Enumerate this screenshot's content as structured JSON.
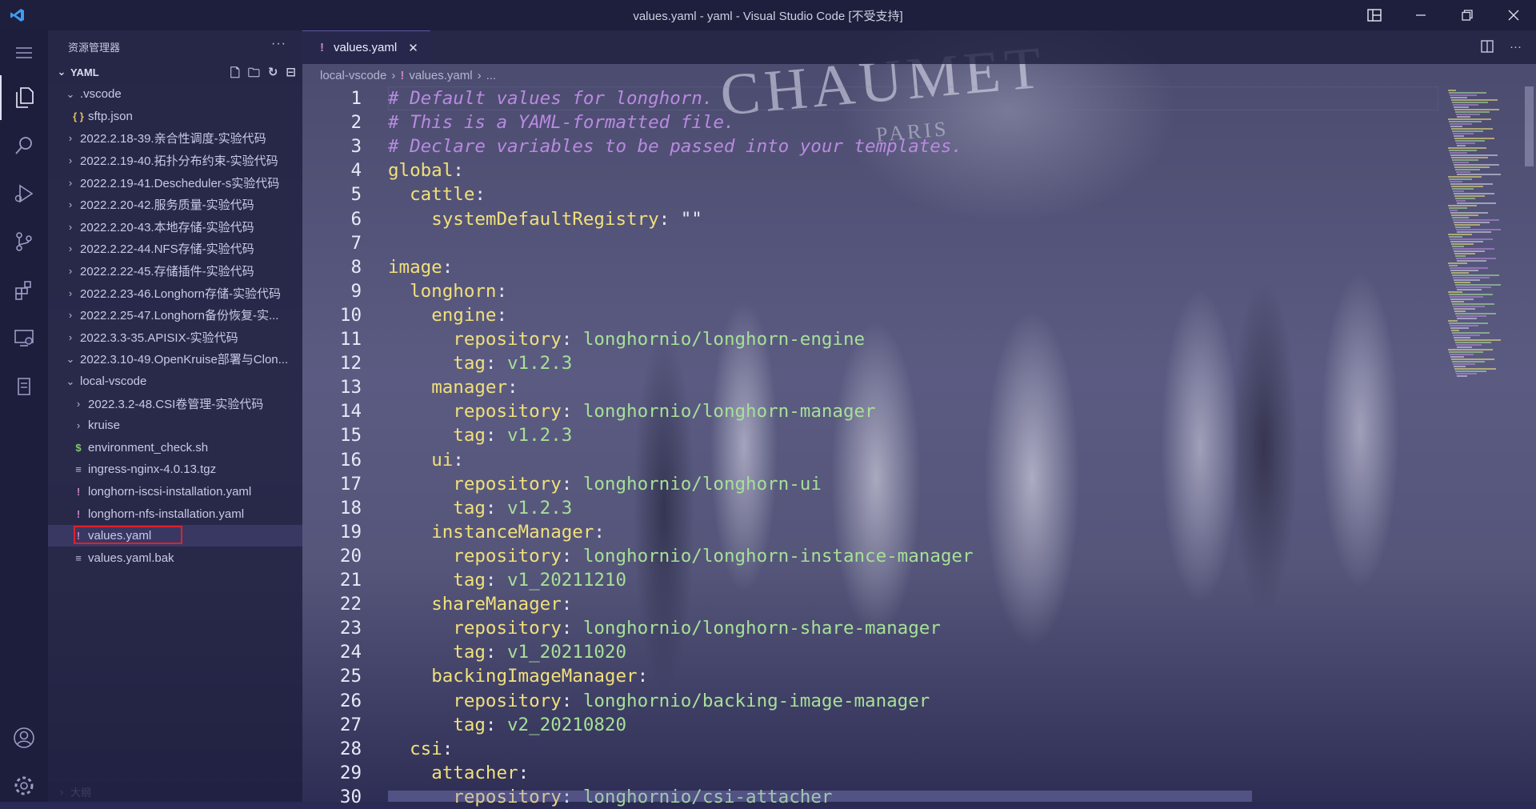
{
  "window": {
    "title": "values.yaml - yaml - Visual Studio Code [不受支持]"
  },
  "explorer": {
    "header": "资源管理器",
    "more": "···",
    "section": "YAML",
    "outline": "大纲",
    "tree": [
      {
        "label": ".vscode",
        "type": "folder",
        "open": true,
        "depth": 1
      },
      {
        "label": "sftp.json",
        "type": "json",
        "depth": 2
      },
      {
        "label": "2022.2.18-39.亲合性调度-实验代码",
        "type": "folder",
        "open": false,
        "depth": 1
      },
      {
        "label": "2022.2.19-40.拓扑分布约束-实验代码",
        "type": "folder",
        "open": false,
        "depth": 1
      },
      {
        "label": "2022.2.19-41.Descheduler-s实验代码",
        "type": "folder",
        "open": false,
        "depth": 1
      },
      {
        "label": "2022.2.20-42.服务质量-实验代码",
        "type": "folder",
        "open": false,
        "depth": 1
      },
      {
        "label": "2022.2.20-43.本地存储-实验代码",
        "type": "folder",
        "open": false,
        "depth": 1
      },
      {
        "label": "2022.2.22-44.NFS存储-实验代码",
        "type": "folder",
        "open": false,
        "depth": 1
      },
      {
        "label": "2022.2.22-45.存储插件-实验代码",
        "type": "folder",
        "open": false,
        "depth": 1
      },
      {
        "label": "2022.2.23-46.Longhorn存储-实验代码",
        "type": "folder",
        "open": false,
        "depth": 1
      },
      {
        "label": "2022.2.25-47.Longhorn备份恢复-实...",
        "type": "folder",
        "open": false,
        "depth": 1
      },
      {
        "label": "2022.3.3-35.APISIX-实验代码",
        "type": "folder",
        "open": false,
        "depth": 1
      },
      {
        "label": "2022.3.10-49.OpenKruise部署与Clon...",
        "type": "folder",
        "open": true,
        "depth": 1
      },
      {
        "label": "local-vscode",
        "type": "folder",
        "open": true,
        "depth": 1
      },
      {
        "label": "2022.3.2-48.CSI卷管理-实验代码",
        "type": "folder",
        "open": false,
        "depth": 2
      },
      {
        "label": "kruise",
        "type": "folder",
        "open": false,
        "depth": 2
      },
      {
        "label": "environment_check.sh",
        "type": "shell",
        "depth": 2
      },
      {
        "label": "ingress-nginx-4.0.13.tgz",
        "type": "file",
        "depth": 2
      },
      {
        "label": "longhorn-iscsi-installation.yaml",
        "type": "yaml",
        "depth": 2
      },
      {
        "label": "longhorn-nfs-installation.yaml",
        "type": "yaml",
        "depth": 2
      },
      {
        "label": "values.yaml",
        "type": "yaml",
        "depth": 2,
        "selected": true
      },
      {
        "label": "values.yaml.bak",
        "type": "file",
        "depth": 2
      }
    ]
  },
  "tab": {
    "label": "values.yaml",
    "close": "✕"
  },
  "breadcrumb": [
    "local-vscode",
    "values.yaml",
    "..."
  ],
  "editor": {
    "lines": [
      [
        [
          "comment",
          "# Default values for longhorn."
        ]
      ],
      [
        [
          "comment",
          "# This is a YAML-formatted file."
        ]
      ],
      [
        [
          "comment",
          "# Declare variables to be passed into your templates."
        ]
      ],
      [
        [
          "key",
          "global"
        ],
        [
          "punc",
          ":"
        ]
      ],
      [
        [
          "punc",
          "  "
        ],
        [
          "key",
          "cattle"
        ],
        [
          "punc",
          ":"
        ]
      ],
      [
        [
          "punc",
          "    "
        ],
        [
          "key",
          "systemDefaultRegistry"
        ],
        [
          "punc",
          ": "
        ],
        [
          "str",
          "\"\""
        ]
      ],
      [],
      [
        [
          "key",
          "image"
        ],
        [
          "punc",
          ":"
        ]
      ],
      [
        [
          "punc",
          "  "
        ],
        [
          "key",
          "longhorn"
        ],
        [
          "punc",
          ":"
        ]
      ],
      [
        [
          "punc",
          "    "
        ],
        [
          "key",
          "engine"
        ],
        [
          "punc",
          ":"
        ]
      ],
      [
        [
          "punc",
          "      "
        ],
        [
          "key",
          "repository"
        ],
        [
          "punc",
          ": "
        ],
        [
          "val",
          "longhornio/longhorn-engine"
        ]
      ],
      [
        [
          "punc",
          "      "
        ],
        [
          "key",
          "tag"
        ],
        [
          "punc",
          ": "
        ],
        [
          "val",
          "v1.2.3"
        ]
      ],
      [
        [
          "punc",
          "    "
        ],
        [
          "key",
          "manager"
        ],
        [
          "punc",
          ":"
        ]
      ],
      [
        [
          "punc",
          "      "
        ],
        [
          "key",
          "repository"
        ],
        [
          "punc",
          ": "
        ],
        [
          "val",
          "longhornio/longhorn-manager"
        ]
      ],
      [
        [
          "punc",
          "      "
        ],
        [
          "key",
          "tag"
        ],
        [
          "punc",
          ": "
        ],
        [
          "val",
          "v1.2.3"
        ]
      ],
      [
        [
          "punc",
          "    "
        ],
        [
          "key",
          "ui"
        ],
        [
          "punc",
          ":"
        ]
      ],
      [
        [
          "punc",
          "      "
        ],
        [
          "key",
          "repository"
        ],
        [
          "punc",
          ": "
        ],
        [
          "val",
          "longhornio/longhorn-ui"
        ]
      ],
      [
        [
          "punc",
          "      "
        ],
        [
          "key",
          "tag"
        ],
        [
          "punc",
          ": "
        ],
        [
          "val",
          "v1.2.3"
        ]
      ],
      [
        [
          "punc",
          "    "
        ],
        [
          "key",
          "instanceManager"
        ],
        [
          "punc",
          ":"
        ]
      ],
      [
        [
          "punc",
          "      "
        ],
        [
          "key",
          "repository"
        ],
        [
          "punc",
          ": "
        ],
        [
          "val",
          "longhornio/longhorn-instance-manager"
        ]
      ],
      [
        [
          "punc",
          "      "
        ],
        [
          "key",
          "tag"
        ],
        [
          "punc",
          ": "
        ],
        [
          "val",
          "v1_20211210"
        ]
      ],
      [
        [
          "punc",
          "    "
        ],
        [
          "key",
          "shareManager"
        ],
        [
          "punc",
          ":"
        ]
      ],
      [
        [
          "punc",
          "      "
        ],
        [
          "key",
          "repository"
        ],
        [
          "punc",
          ": "
        ],
        [
          "val",
          "longhornio/longhorn-share-manager"
        ]
      ],
      [
        [
          "punc",
          "      "
        ],
        [
          "key",
          "tag"
        ],
        [
          "punc",
          ": "
        ],
        [
          "val",
          "v1_20211020"
        ]
      ],
      [
        [
          "punc",
          "    "
        ],
        [
          "key",
          "backingImageManager"
        ],
        [
          "punc",
          ":"
        ]
      ],
      [
        [
          "punc",
          "      "
        ],
        [
          "key",
          "repository"
        ],
        [
          "punc",
          ": "
        ],
        [
          "val",
          "longhornio/backing-image-manager"
        ]
      ],
      [
        [
          "punc",
          "      "
        ],
        [
          "key",
          "tag"
        ],
        [
          "punc",
          ": "
        ],
        [
          "val",
          "v2_20210820"
        ]
      ],
      [
        [
          "punc",
          "  "
        ],
        [
          "key",
          "csi"
        ],
        [
          "punc",
          ":"
        ]
      ],
      [
        [
          "punc",
          "    "
        ],
        [
          "key",
          "attacher"
        ],
        [
          "punc",
          ":"
        ]
      ],
      [
        [
          "punc",
          "      "
        ],
        [
          "key",
          "repository"
        ],
        [
          "punc",
          ": "
        ],
        [
          "val",
          "longhornio/csi-attacher"
        ]
      ]
    ]
  },
  "watermark": {
    "brand": "CHAUMET",
    "sub": "PARIS"
  },
  "colors": {
    "comment": "#b98ae0",
    "key": "#f0e07a",
    "value": "#a6e096",
    "yaml_icon": "#c586c0",
    "selection_outline": "#e0202a"
  },
  "icons": {
    "activity": [
      "explorer-icon",
      "search-icon",
      "run-debug-icon",
      "source-control-icon",
      "extensions-icon",
      "remote-explorer-icon",
      "clipboard-icon",
      "account-icon",
      "settings-gear-icon"
    ]
  }
}
